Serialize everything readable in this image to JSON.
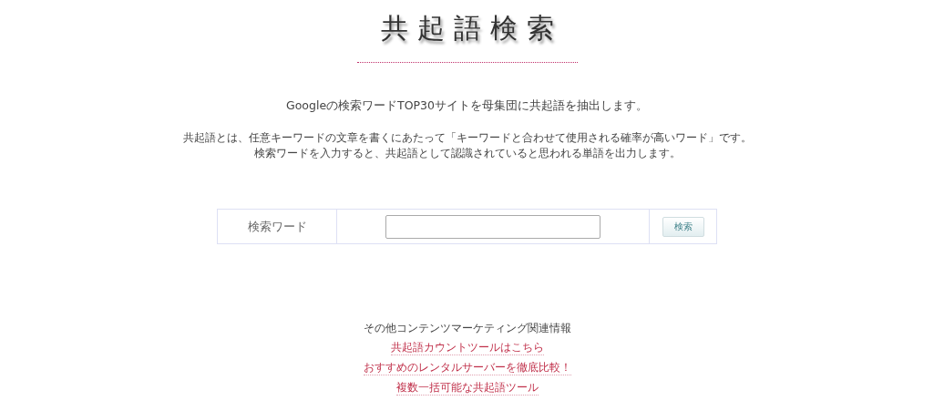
{
  "title": "共起語検索",
  "lead": "Googleの検索ワードTOP30サイトを母集団に共起語を抽出します。",
  "description": [
    "共起語とは、任意キーワードの文章を書くにあたって「キーワードと合わせて使用される確率が高いワード」です。",
    "検索ワードを入力すると、共起語として認識されていると思われる単語を出力します。"
  ],
  "form": {
    "label": "検索ワード",
    "button": "検索"
  },
  "related": {
    "heading": "その他コンテンツマーケティング関連情報",
    "links": [
      "共起語カウントツールはこちら",
      "おすすめのレンタルサーバーを徹底比較！",
      "複数一括可能な共起語ツール"
    ]
  }
}
